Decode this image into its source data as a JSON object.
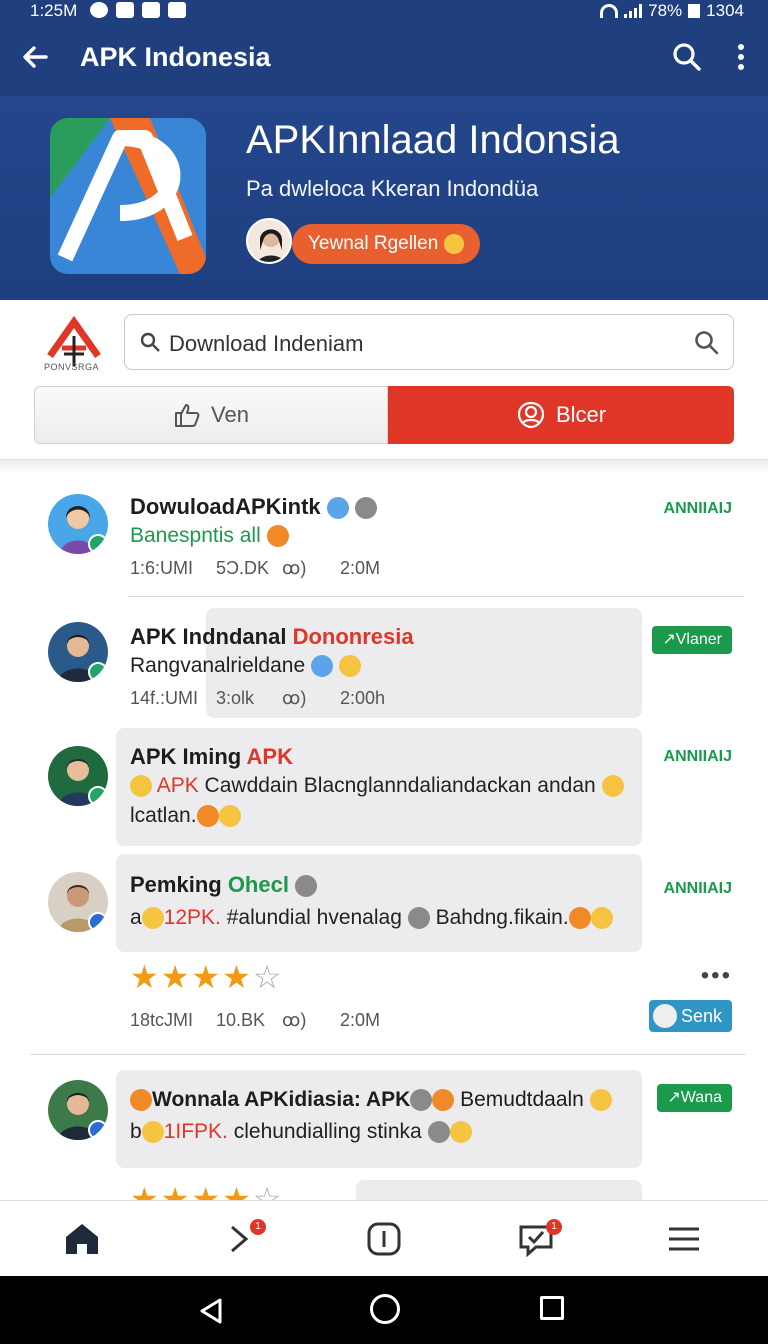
{
  "status": {
    "time": "1:25M",
    "battery": "78%",
    "right_text": "1304"
  },
  "appbar": {
    "title": "APK Indonesia"
  },
  "banner": {
    "title": "APKInnlaad Indonsia",
    "subtitle": "Pa dwleloca Kkeran Indondüa",
    "developer": "Yewnal Rgellen"
  },
  "brand": {
    "text": "PONVSRGA"
  },
  "search": {
    "query": "Download Indeniam"
  },
  "toggle": {
    "view_label": "Ven",
    "block_label": "Blcer"
  },
  "posts": [
    {
      "title": "DowuloadAPKintk",
      "text": "Banespntis all",
      "meta": {
        "time": "1:6:UMI",
        "downloads": "5Ͻ.DK",
        "likes": "ꝏ)",
        "size": "2:0M"
      },
      "tag": "ANNIIAIJ"
    },
    {
      "title": "APK Indndanal ",
      "title_highlight": "Dononresia",
      "text": "Rangvanalrieldane",
      "meta": {
        "time": "14f.:UMI",
        "downloads": "3:olk",
        "likes": "ꝏ)",
        "size": "2:00h"
      },
      "tag": "Vlaner"
    },
    {
      "title": "APK Iming ",
      "title_highlight": "APK",
      "text_prefix": "APK",
      "text": " Cawddain Blacnglanndaliandackan andan",
      "text2": "lcatlan.",
      "tag": "ANNIIAIJ"
    },
    {
      "title": "Pemking ",
      "title_highlight": "Ohecl",
      "text_a": "a",
      "text_prefix": "12PK.",
      "text": " #alundial hvenalag",
      "text_b": "Bahdng.fikain.",
      "rating": 4,
      "meta": {
        "time": "18tcJMI",
        "downloads": "10.BK",
        "likes": "ꝏ)",
        "size": "2:0M"
      },
      "tag": "ANNIIAIJ",
      "more": "•••",
      "send_label": "Senk"
    },
    {
      "title": "Wonnala APKidiasia: APK",
      "text_after": "Bemudtdaaln",
      "text_b_prefix": "b",
      "text_prefix": "1IFPK.",
      "text": " clehundialling stinka",
      "tag": "Wana"
    }
  ],
  "bottomnav": {
    "badge1": "1",
    "badge2": "1"
  },
  "colors": {
    "primary": "#1f3f7e",
    "accent": "#df3628",
    "green": "#1a9a4a",
    "star": "#f29a16"
  }
}
